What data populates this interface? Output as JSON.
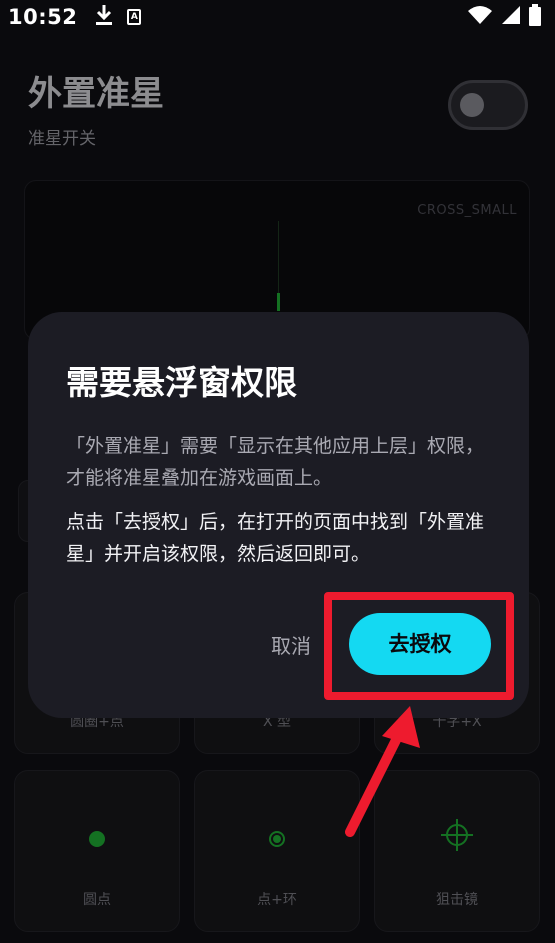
{
  "status_bar": {
    "time": "10:52",
    "left_icons": [
      "download-icon",
      "a-badge-icon"
    ],
    "a_badge": "A",
    "right_icons": [
      "wifi-icon",
      "signal-icon",
      "battery-icon"
    ]
  },
  "background": {
    "title": "外置准星",
    "subtitle": "准星开关",
    "toggle_on": false,
    "preview_label": "CROSS_SMALL",
    "tiles": [
      {
        "label": "圆圈+点"
      },
      {
        "label": "X 型"
      },
      {
        "label": "十字+X"
      },
      {
        "label": "圆点",
        "icon": "dot-icon"
      },
      {
        "label": "点+环",
        "icon": "dot-ring-icon"
      },
      {
        "label": "狙击镜",
        "icon": "scope-icon"
      }
    ],
    "accent_green": "#1fae35"
  },
  "dialog": {
    "title": "需要悬浮窗权限",
    "description": "「外置准星」需要「显示在其他应用上层」权限，才能将准星叠加在游戏画面上。",
    "instruction": "点击「去授权」后，在打开的页面中找到「外置准星」并开启该权限，然后返回即可。",
    "cancel_label": "取消",
    "authorize_label": "去授权",
    "accent_color": "#14d9f2"
  },
  "annotation": {
    "highlight_color": "#ee1b2e"
  }
}
